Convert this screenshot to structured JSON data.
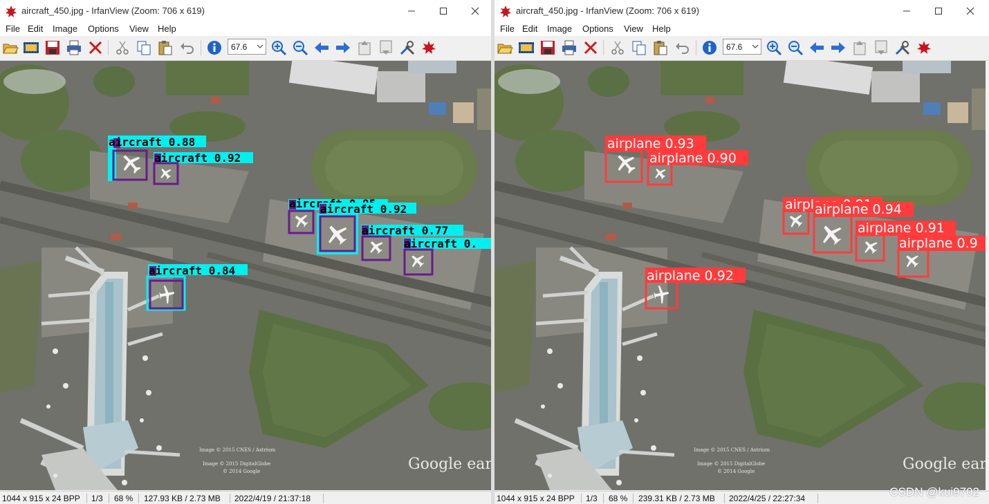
{
  "left_window": {
    "title": "aircraft_450.jpg - IrfanView (Zoom: 706 x 619)",
    "menu": [
      "File",
      "Edit",
      "Image",
      "Options",
      "View",
      "Help"
    ],
    "zoom_value": "67.6",
    "status": [
      "1044 x 915 x 24 BPP",
      "1/3",
      "68 %",
      "127.93 KB / 2.73 MB",
      "2022/4/19 / 21:37:18"
    ],
    "detections": [
      {
        "label": "aircraft 0.88",
        "mark": "0"
      },
      {
        "label": "aircraft 0.92",
        "mark": "0"
      },
      {
        "label": "aircraft 0.95",
        "mark": "0"
      },
      {
        "label": "aircraft 0.92",
        "mark": "0"
      },
      {
        "label": "aircraft 0.77",
        "mark": "0"
      },
      {
        "label": "aircraft 0.",
        "mark": "0"
      },
      {
        "label": "aircraft 0.84",
        "mark": "0"
      }
    ],
    "box_color": "#6a1b8a",
    "label_color": "#00f0f0"
  },
  "right_window": {
    "title": "aircraft_450.jpg - IrfanView (Zoom: 706 x 619)",
    "menu": [
      "File",
      "Edit",
      "Image",
      "Options",
      "View",
      "Help"
    ],
    "zoom_value": "67.6",
    "status": [
      "1044 x 915 x 24 BPP",
      "1/3",
      "68 %",
      "239.31 KB / 2.73 MB",
      "2022/4/25 / 22:27:34"
    ],
    "detections": [
      {
        "label": "airplane 0.93"
      },
      {
        "label": "airplane 0.90"
      },
      {
        "label": "airplane 0.91"
      },
      {
        "label": "airplane 0.94"
      },
      {
        "label": "airplane 0.91"
      },
      {
        "label": "airplane 0.9"
      },
      {
        "label": "airplane 0.92"
      }
    ],
    "box_color": "#ff3b3b"
  },
  "image_text": {
    "google_earth": "Google earth",
    "credit_1": "Image © 2015 CNES / Astrium",
    "credit_2": "Image © 2015 DigitalGlobe",
    "credit_3": "© 2014 Google"
  },
  "watermark": "CSDN @kui9702",
  "toolbar_icons": [
    "open-folder-icon",
    "slideshow-icon",
    "save-icon",
    "print-icon",
    "delete-icon",
    "cut-icon",
    "copy-icon",
    "paste-icon",
    "undo-icon",
    "info-icon",
    "zoom-select",
    "zoom-in-icon",
    "zoom-out-icon",
    "previous-icon",
    "next-icon",
    "first-page-icon",
    "last-page-icon",
    "tools-icon",
    "irfanview-logo-icon"
  ]
}
